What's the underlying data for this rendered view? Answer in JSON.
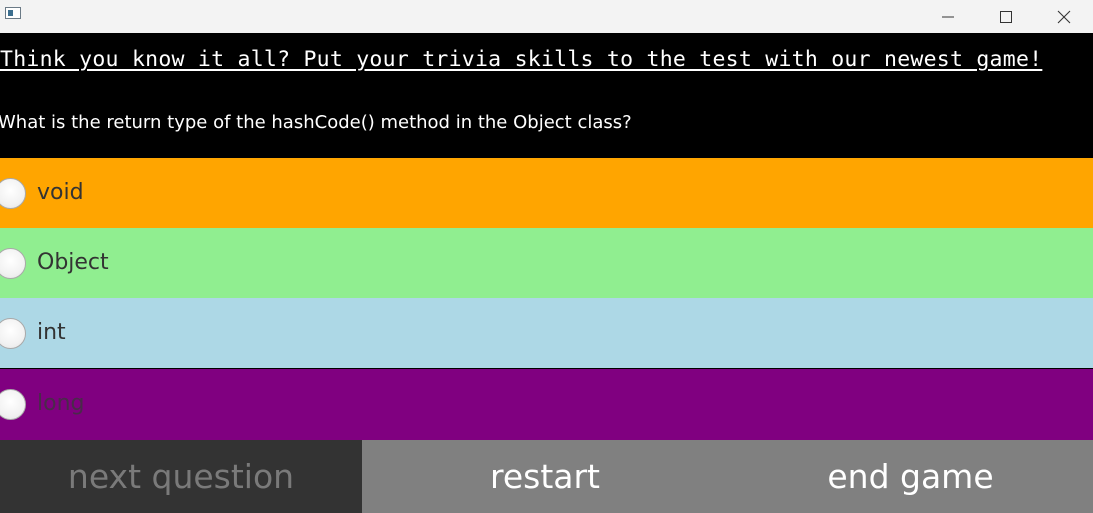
{
  "window": {
    "icon": "app-window-icon",
    "controls": [
      "minimize-icon",
      "maximize-icon",
      "close-icon"
    ]
  },
  "header": {
    "headline": "Think you know it all? Put your trivia skills to the test with our newest game!",
    "question": "What is the return type of the hashCode() method in the Object class?"
  },
  "options": [
    {
      "label": "void",
      "color": "#FFA500",
      "text_color": "#333333"
    },
    {
      "label": "Object",
      "color": "#90EE90",
      "text_color": "#333333"
    },
    {
      "label": "int",
      "color": "#ADD8E6",
      "text_color": "#333333"
    },
    {
      "label": "long",
      "color": "#800080",
      "text_color": "#4a2a4a"
    }
  ],
  "footer": {
    "next_label": "next question",
    "restart_label": "restart",
    "end_label": "end game",
    "next_bg": "#333333",
    "next_text": "#7a7a7a",
    "restart_bg": "#808080",
    "end_bg": "#808080",
    "button_text": "#ffffff"
  }
}
